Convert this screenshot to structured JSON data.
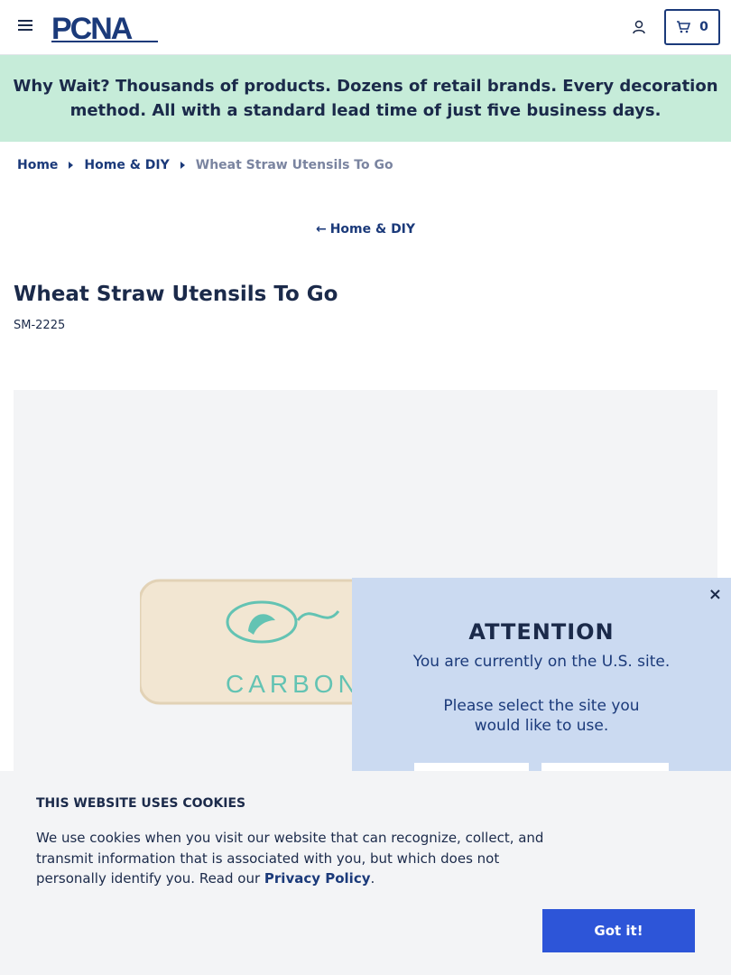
{
  "header": {
    "logo_text": "PCNA",
    "cart_count": "0"
  },
  "promo": {
    "text": "Why Wait? Thousands of products. Dozens of retail brands. Every decoration method. All with a standard lead time of just five business days."
  },
  "breadcrumb": {
    "items": [
      "Home",
      "Home & DIY",
      "Wheat Straw Utensils To Go"
    ]
  },
  "back_link": {
    "label": "Home & DIY"
  },
  "product": {
    "title": "Wheat Straw Utensils To Go",
    "sku": "SM-2225",
    "image_brand_text": "CARBON"
  },
  "modal": {
    "title": "ATTENTION",
    "line1": "You are currently on the U.S. site.",
    "line2": "Please select the site you",
    "line3": "would like to use.",
    "close_label": "×"
  },
  "cookie": {
    "heading": "THIS WEBSITE USES COOKIES",
    "body_before": "We use cookies when you visit our website that can recognize, collect, and transmit information that is associated with you, but which does not personally identify you. Read our ",
    "privacy_link": "Privacy Policy",
    "body_after": ".",
    "button_label": "Got it!"
  },
  "colors": {
    "brand_navy": "#1b2a4a",
    "promo_green": "#c6ecd9",
    "modal_blue": "#cbdaf1",
    "button_blue": "#2d55d8"
  }
}
